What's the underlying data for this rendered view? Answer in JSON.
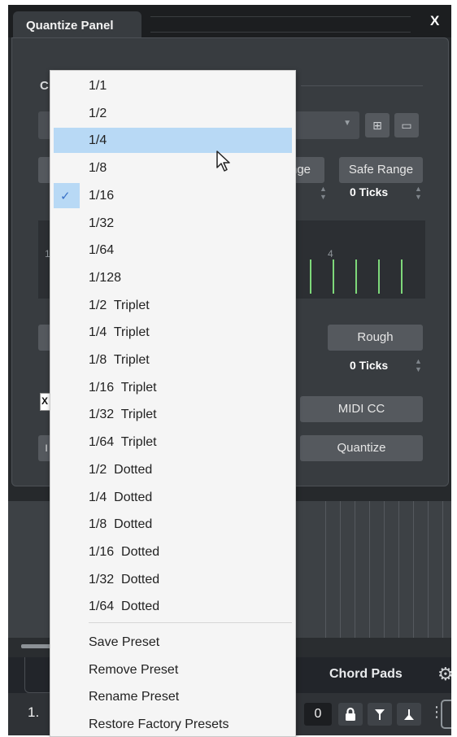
{
  "window": {
    "tab_title": "Quantize Panel",
    "close_label": "X"
  },
  "panel": {
    "section_letter": "C",
    "range_label_partial": "nge",
    "safe_range_label": "Safe Range",
    "safe_range_value": "0 Ticks",
    "grid_numbers": [
      "1",
      "4"
    ],
    "rough_label": "Rough",
    "rough_value": "0 Ticks",
    "checkbox_mark": "X",
    "midi_cc_label": "MIDI CC",
    "quantize_label": "Quantize",
    "left_edge_letter": "I"
  },
  "bottom_bar": {
    "chord_pads_label": "Chord Pads"
  },
  "transport": {
    "position_prefix": "1.",
    "counter_value": "0"
  },
  "menu": {
    "selected_index": 4,
    "hovered_index": 2,
    "note_values": [
      "1/1",
      "1/2",
      "1/4",
      "1/8",
      "1/16",
      "1/32",
      "1/64",
      "1/128",
      "1/2  Triplet",
      "1/4  Triplet",
      "1/8  Triplet",
      "1/16  Triplet",
      "1/32  Triplet",
      "1/64  Triplet",
      "1/2  Dotted",
      "1/4  Dotted",
      "1/8  Dotted",
      "1/16  Dotted",
      "1/32  Dotted",
      "1/64  Dotted"
    ],
    "preset_actions": [
      "Save Preset",
      "Remove Preset",
      "Rename Preset",
      "Restore Factory Presets"
    ],
    "check_glyph": "✓"
  },
  "colors": {
    "highlight": "#b8d9f5",
    "check": "#3a72c7",
    "grid_line": "#7ed87a",
    "panel": "#383c40"
  }
}
